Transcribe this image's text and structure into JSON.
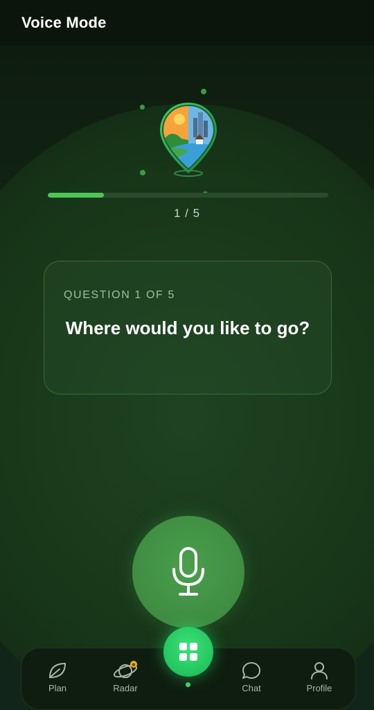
{
  "header": {
    "title": "Voice Mode"
  },
  "progress": {
    "current": 1,
    "total": 5,
    "fraction": 0.2,
    "label": "1 / 5"
  },
  "question": {
    "eyebrow": "QUESTION 1 OF 5",
    "text": "Where would you like to go?"
  },
  "mic": {
    "icon": "microphone-icon"
  },
  "tabs": [
    {
      "label": "Plan",
      "icon": "leaf-icon"
    },
    {
      "label": "Radar",
      "icon": "planet-icon"
    },
    {
      "label": "",
      "icon": "grid-icon"
    },
    {
      "label": "Chat",
      "icon": "chat-bubble-icon"
    },
    {
      "label": "Profile",
      "icon": "user-icon"
    }
  ],
  "colors": {
    "accent": "#22c55e",
    "progress": "#4ec458",
    "mic": "#3f8d42",
    "badge": "#f5b400"
  }
}
